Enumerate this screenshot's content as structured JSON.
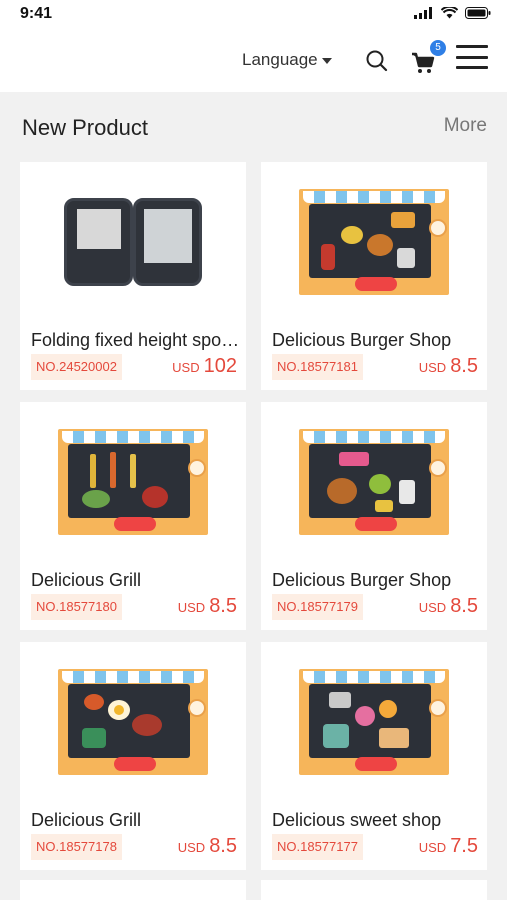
{
  "status_bar": {
    "time": "9:41"
  },
  "header": {
    "language_label": "Language",
    "cart_count": "5"
  },
  "section": {
    "title": "New Product",
    "more_label": "More"
  },
  "products": [
    {
      "name": "Folding fixed height sports gloss oil mat pad",
      "sku": "NO.24520002",
      "currency": "USD",
      "price": "102",
      "image": "briefcase-case"
    },
    {
      "name": "Delicious Burger Shop",
      "sku": "NO.18577181",
      "currency": "USD",
      "price": "8.5",
      "image": "toy-box-burger"
    },
    {
      "name": "Delicious Grill",
      "sku": "NO.18577180",
      "currency": "USD",
      "price": "8.5",
      "image": "toy-box-grill"
    },
    {
      "name": "Delicious Burger Shop",
      "sku": "NO.18577179",
      "currency": "USD",
      "price": "8.5",
      "image": "toy-box-burger"
    },
    {
      "name": "Delicious Grill",
      "sku": "NO.18577178",
      "currency": "USD",
      "price": "8.5",
      "image": "toy-box-grill"
    },
    {
      "name": "Delicious sweet shop",
      "sku": "NO.18577177",
      "currency": "USD",
      "price": "7.5",
      "image": "toy-box-sweets"
    }
  ],
  "colors": {
    "accent": "#e4493c",
    "sku_bg": "#fdeee4",
    "badge": "#2f7fe6"
  }
}
